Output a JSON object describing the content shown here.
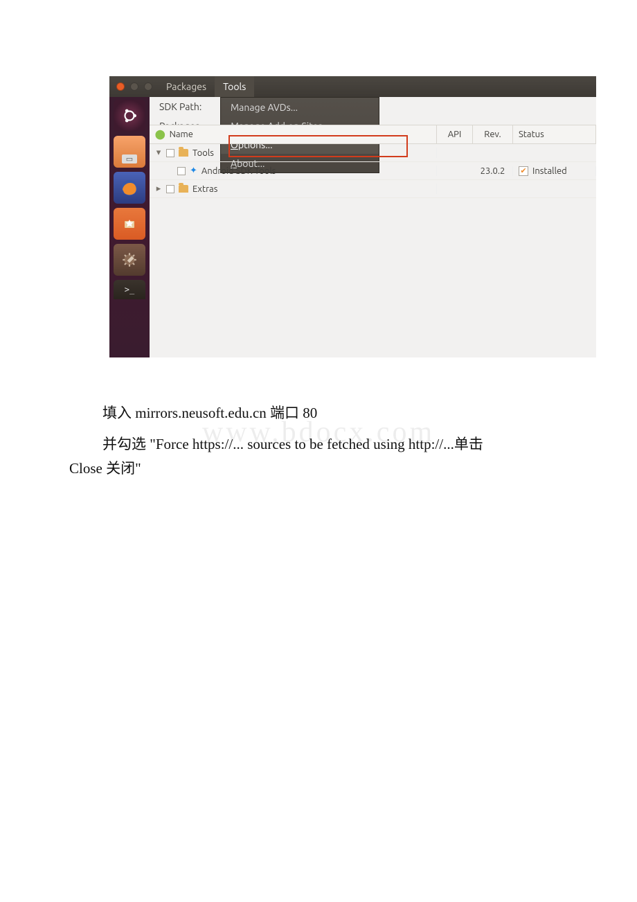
{
  "menubar": {
    "packages": "Packages",
    "tools": "Tools"
  },
  "sdk": {
    "path_label": "SDK Path:",
    "packages_label": "Packages"
  },
  "dropdown": {
    "manage_avds": "Manage AVDs...",
    "manage_addons": "Manage Add-on Sites...",
    "options": "Options...",
    "about": "About..."
  },
  "table": {
    "head": {
      "name": "Name",
      "api": "API",
      "rev": "Rev.",
      "status": "Status"
    },
    "rows": {
      "tools_folder": "Tools",
      "sdk_tools": "Android SDK Tools",
      "sdk_tools_rev": "23.0.2",
      "sdk_tools_status": "Installed",
      "extras": "Extras"
    }
  },
  "watermark": "www.bdocx.com",
  "text": {
    "line1": "填入 mirrors.neusoft.edu.cn 端口 80",
    "line2": "并勾选 \"Force https://... sources to be fetched using http://...单击",
    "line3": "Close 关闭\""
  }
}
